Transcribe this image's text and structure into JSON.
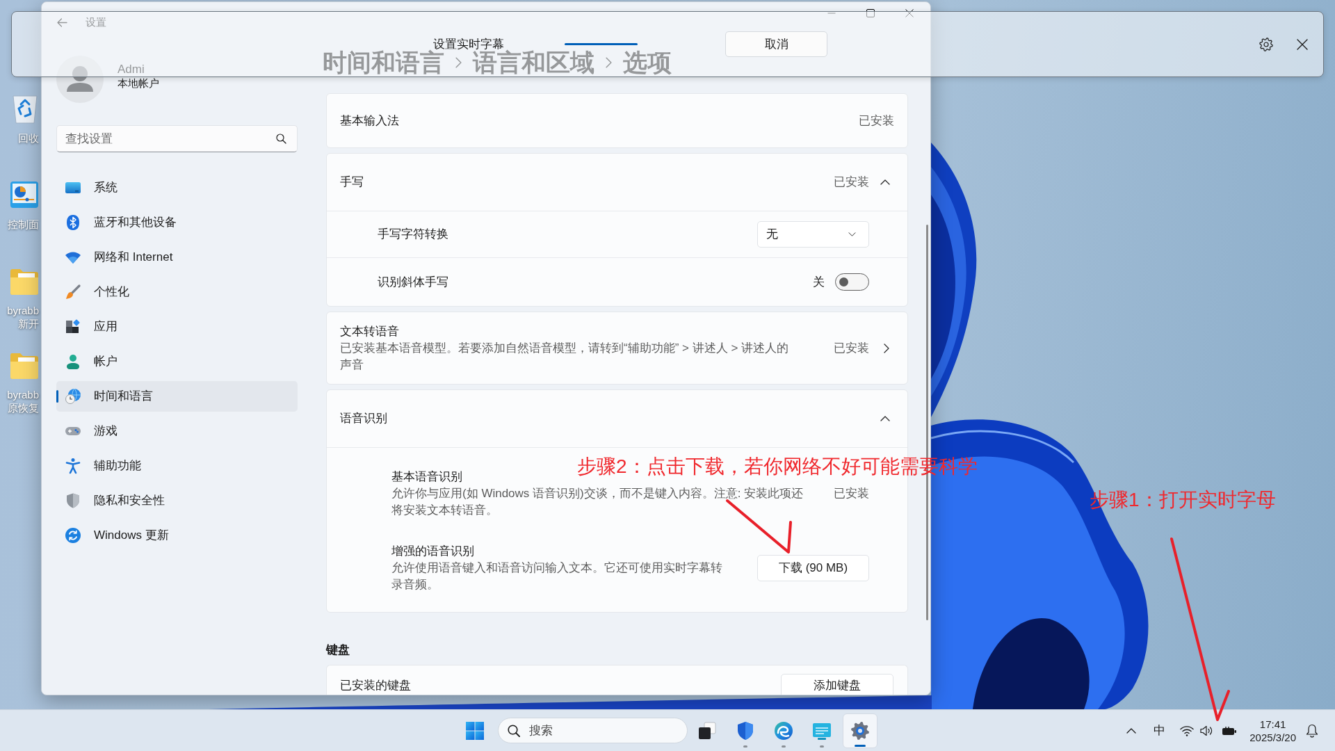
{
  "desktop_icons": [
    {
      "lines": [
        "回收"
      ]
    },
    {
      "lines": [
        "控制面"
      ]
    },
    {
      "lines": [
        "byrabb",
        "新开"
      ]
    },
    {
      "lines": [
        "byrabb",
        "原恢复"
      ]
    }
  ],
  "settings_window": {
    "title": "设置",
    "user": {
      "name": "Admi",
      "account": "本地帐户"
    },
    "search": {
      "placeholder": "查找设置"
    },
    "nav": [
      {
        "label": "系统",
        "selected": false
      },
      {
        "label": "蓝牙和其他设备",
        "selected": false
      },
      {
        "label": "网络和 Internet",
        "selected": false
      },
      {
        "label": "个性化",
        "selected": false
      },
      {
        "label": "应用",
        "selected": false
      },
      {
        "label": "帐户",
        "selected": false
      },
      {
        "label": "时间和语言",
        "selected": true
      },
      {
        "label": "游戏",
        "selected": false
      },
      {
        "label": "辅助功能",
        "selected": false
      },
      {
        "label": "隐私和安全性",
        "selected": false
      },
      {
        "label": "Windows 更新",
        "selected": false
      }
    ],
    "breadcrumb": [
      "时间和语言",
      "语言和区域",
      "选项"
    ],
    "cards": [
      {
        "kind": "status",
        "title": "基本输入法",
        "status": "已安装"
      },
      {
        "kind": "expander",
        "title": "手写",
        "status": "已安装",
        "expanded": true,
        "rows": [
          {
            "kind": "dropdown",
            "label": "手写字符转换",
            "value": "无"
          },
          {
            "kind": "toggle",
            "label": "识别斜体手写",
            "state": "关",
            "on": false
          }
        ]
      },
      {
        "kind": "link",
        "title": "文本转语音",
        "description": [
          "已安装基本语音模型。若要添加自然语音模型，请转到“辅助功能” > 讲述人 > 讲述人的",
          "声音"
        ],
        "status": "已安装"
      },
      {
        "kind": "expander",
        "title": "语音识别",
        "expanded": true,
        "rows": [
          {
            "kind": "status",
            "label": "基本语音识别",
            "description": [
              "允许你与应用(如 Windows 语音识别)交谈，而不是键入内容。注意: 安装此项还",
              "将安装文本转语音。"
            ],
            "status": "已安装"
          },
          {
            "kind": "button",
            "label": "增强的语音识别",
            "description": [
              "允许使用语音键入和语音访问输入文本。它还可使用实时字幕转",
              "录音频。"
            ],
            "button": "下载 (90 MB)"
          }
        ]
      }
    ],
    "keyboard": {
      "heading": "键盘",
      "card": {
        "title": "已安装的键盘",
        "button": "添加键盘"
      }
    }
  },
  "live_captions": {
    "status": "设置实时字幕",
    "cancel": "取消"
  },
  "taskbar": {
    "search": {
      "placeholder": "搜索"
    },
    "apps": [
      {
        "running": false,
        "active": false
      },
      {
        "running": true,
        "active": false
      },
      {
        "running": true,
        "active": false
      },
      {
        "running": true,
        "active": false
      },
      {
        "running": true,
        "active": true
      }
    ],
    "tray": {
      "ime": "中",
      "time": "17:41",
      "date": "2025/3/20"
    }
  },
  "annotations": [
    {
      "text": "步骤2：点击下载，若你网络不好可能需要科学"
    },
    {
      "text": "步骤1：打开实时字母"
    }
  ]
}
